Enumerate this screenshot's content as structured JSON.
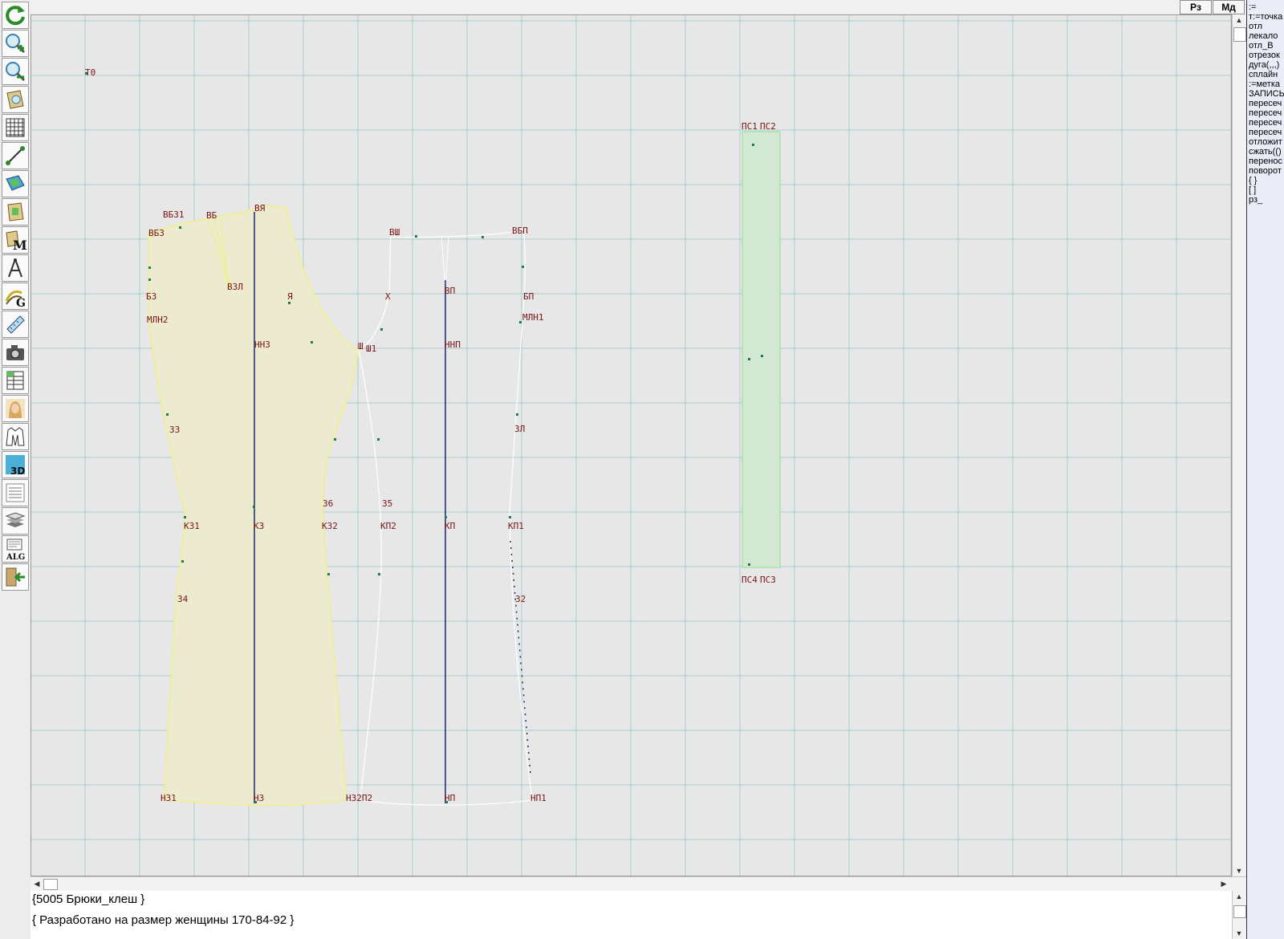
{
  "topbar": {
    "rz_label": "Рз",
    "md_label": "Мд"
  },
  "toolbar": {
    "tools": [
      {
        "name": "refresh-icon"
      },
      {
        "name": "zoom-in-icon"
      },
      {
        "name": "zoom-out-icon"
      },
      {
        "name": "pattern-view-icon"
      },
      {
        "name": "grid-icon"
      },
      {
        "name": "line-tool-icon"
      },
      {
        "name": "map-icon"
      },
      {
        "name": "pattern-piece-icon"
      },
      {
        "name": "measurements-icon"
      },
      {
        "name": "compass-icon"
      },
      {
        "name": "curve-tool-icon"
      },
      {
        "name": "ruler-icon"
      },
      {
        "name": "camera-icon"
      },
      {
        "name": "table-icon"
      },
      {
        "name": "woman-portrait-icon"
      },
      {
        "name": "garment-icon"
      },
      {
        "name": "view-3d-icon",
        "text": "3D"
      },
      {
        "name": "document-list-icon"
      },
      {
        "name": "layers-icon"
      },
      {
        "name": "algorithm-icon",
        "text": "ALG"
      },
      {
        "name": "exit-icon"
      }
    ]
  },
  "canvas": {
    "labels": [
      "Т0",
      "ВБ31",
      "ВБ3",
      "Б3",
      "МЛН2",
      "В3Л",
      "Я",
      "НН3",
      "ВБ",
      "ВЯ",
      "Ш",
      "Ш1",
      "Х",
      "ВШ",
      "ВП",
      "ВБП",
      "БП",
      "МЛН1",
      "ННП",
      "З3",
      "ЗЛ",
      "З6",
      "З5",
      "К31",
      "К3",
      "К32",
      "КП2",
      "КП",
      "КП1",
      "З4",
      "З2",
      "Н31",
      "Н3",
      "Н32П2",
      "НП",
      "НП1",
      "ПС1",
      "ПС2",
      "ПС4",
      "ПС3"
    ]
  },
  "command_panel": {
    "items": [
      ":=",
      "т:=точка",
      "отл",
      "лекало",
      "отл_В",
      "отрезок",
      "дуга(,,,)",
      "сплайн",
      ":=метка",
      "ЗАПИСЬ",
      "пересеч",
      "пересеч",
      "пересеч",
      "пересеч",
      "отложит",
      "сжать(()",
      "перенос",
      "поворот",
      "{ }",
      "[ ]",
      "рз_"
    ]
  },
  "text_area": {
    "line1": "{5005  Брюки_клеш }",
    "line2": "{ Разработано на размер женщины 170-84-92 }"
  },
  "colors": {
    "canvas_bg": "#e7e7e7",
    "grid": "#a9cfcf",
    "piece_fill": "#ecebcf",
    "piece_outline": "#f2f07a",
    "green_piece": "#d2e8d2",
    "label": "#7a1414",
    "axis_line": "#1a2a6e"
  }
}
